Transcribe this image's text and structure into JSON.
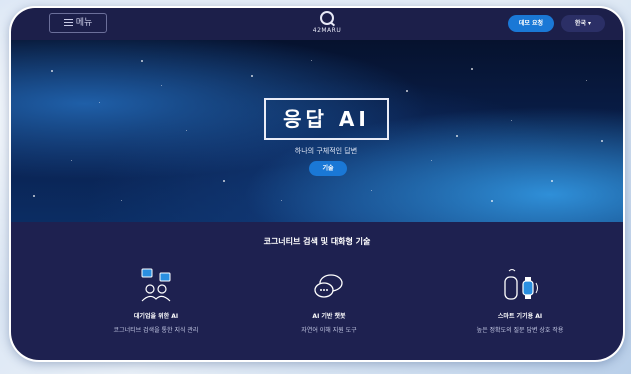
{
  "nav": {
    "menu_label": "메뉴",
    "logo_text": "42MARU",
    "demo_label": "데모 요청",
    "lang_label": "한국 ▾"
  },
  "hero": {
    "title": "응답 AI",
    "subtitle": "하나의 구체적인 답변",
    "tech_button": "기술",
    "slides": 3,
    "active_slide": 0
  },
  "section": {
    "title": "코그너티브 검색 및 대화형 기술",
    "features": [
      {
        "name": "대기업을 위한 AI",
        "desc": "코그너티브 검색을 통한 지식 관리",
        "icon": "enterprise-chat-icon"
      },
      {
        "name": "AI 기반 챗봇",
        "desc": "자연어 이해 지원 도구",
        "icon": "chat-bubbles-icon"
      },
      {
        "name": "스마트 기기용 AI",
        "desc": "높은 정확도의 질문 답변 상호 작용",
        "icon": "smart-devices-icon"
      }
    ]
  },
  "colors": {
    "nav_bg": "#1c1f4a",
    "accent": "#1a78d6",
    "section_bg": "#1e2150"
  }
}
